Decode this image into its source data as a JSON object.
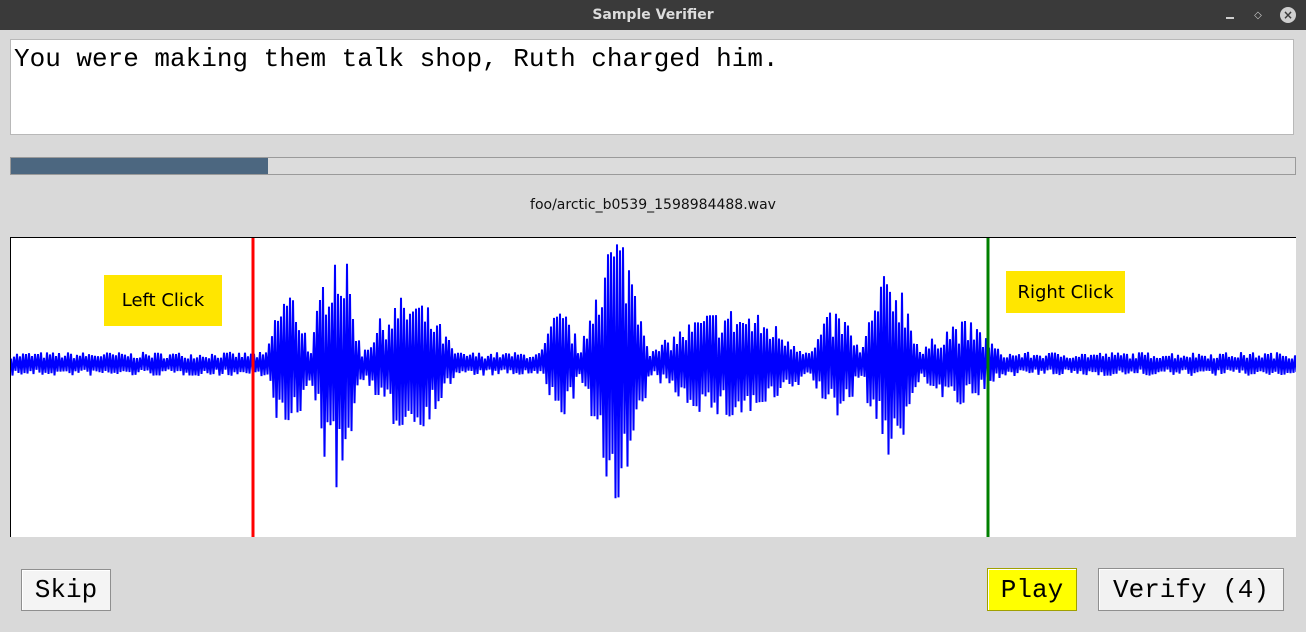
{
  "window": {
    "title": "Sample Verifier",
    "controls": {
      "minimize": "minimize-icon",
      "maximize": "maximize-icon",
      "close": "close-icon"
    }
  },
  "sentence": "You were making them talk shop, Ruth charged him.",
  "progress": {
    "fraction": 0.2,
    "fill_color": "#4c6780"
  },
  "filename": "foo/arctic_b0539_1598984488.wav",
  "waveform": {
    "line_color": "#0000ff",
    "left_marker_color": "#ff0000",
    "right_marker_color": "#008000"
  },
  "hints": {
    "left": "Left Click",
    "right": "Right Click",
    "color": "#ffe600"
  },
  "buttons": {
    "skip": "Skip",
    "play": "Play",
    "verify": "Verify (4)"
  }
}
